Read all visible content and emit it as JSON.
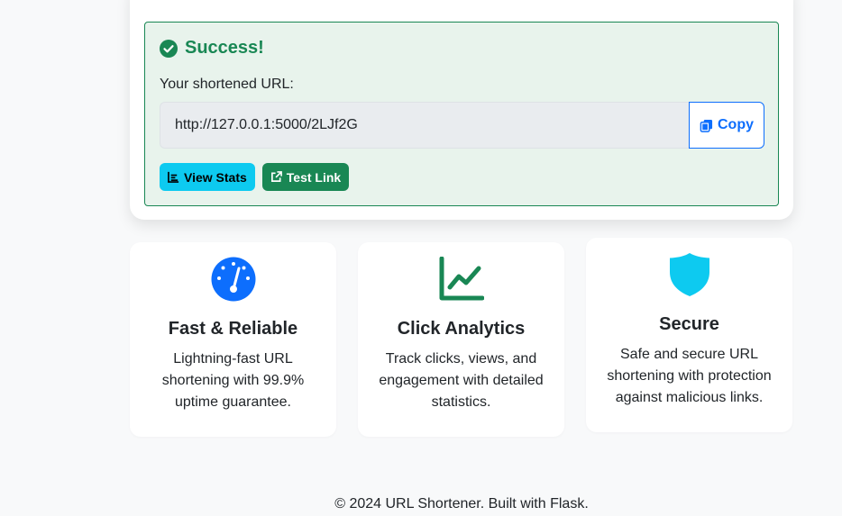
{
  "success": {
    "title": "Success!",
    "label": "Your shortened URL:",
    "short_url": "http://127.0.0.1:5000/2LJf2G",
    "copy_label": "Copy",
    "view_stats_label": "View Stats",
    "test_link_label": "Test Link"
  },
  "features": [
    {
      "icon": "speedometer-icon",
      "title": "Fast & Reliable",
      "text": "Lightning-fast URL shortening with 99.9% uptime guarantee."
    },
    {
      "icon": "line-chart-icon",
      "title": "Click Analytics",
      "text": "Track clicks, views, and engagement with detailed statistics."
    },
    {
      "icon": "shield-icon",
      "title": "Secure",
      "text": "Safe and secure URL shortening with protection against malicious links."
    }
  ],
  "footer": {
    "text": "© 2024 URL Shortener. Built with Flask."
  },
  "colors": {
    "success": "#198754",
    "primary": "#0d6efd",
    "info": "#0dcaf0"
  }
}
